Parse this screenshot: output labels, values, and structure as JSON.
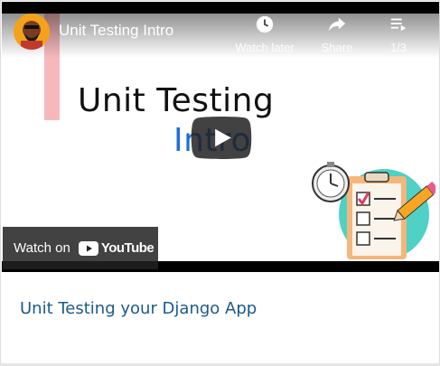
{
  "video": {
    "title": "Unit Testing Intro",
    "thumbnail_line1": "Unit Testing",
    "thumbnail_line2": "Intro",
    "controls": {
      "watch_later": "Watch later",
      "share": "Share",
      "playlist_position": "1/3"
    },
    "watch_on_label": "Watch on",
    "youtube_wordmark": "YouTube",
    "icons": {
      "watch_later": "clock-icon",
      "share": "share-arrow-icon",
      "playlist": "playlist-icon",
      "play": "play-icon",
      "youtube": "youtube-logo-icon"
    }
  },
  "card": {
    "caption": "Unit Testing your Django App"
  },
  "colors": {
    "caption": "#1a5a8a",
    "play_button": "#212121",
    "accent_blue": "#1f6fd1",
    "youtube_red": "#ff0000"
  }
}
